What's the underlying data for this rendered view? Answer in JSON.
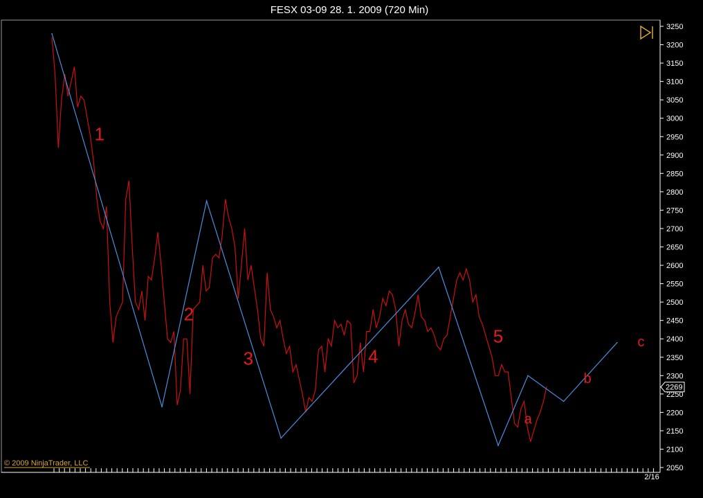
{
  "title": "FESX 03-09  28. 1. 2009 (720 Min)",
  "copyright": "© 2009 NinjaTrader, LLC",
  "last_price_label": "2269",
  "x_tick_label": "2/16",
  "colors": {
    "background": "#000000",
    "price_line": "#cc1111",
    "wave_line": "#4a8fe0",
    "axis": "#ffffff",
    "label": "#e41b1b",
    "copyright": "#d9a930"
  },
  "icons": [
    "play-to-end-icon"
  ],
  "chart_data": {
    "type": "line",
    "ylim": [
      2050,
      3250
    ],
    "y_ticks": [
      2050,
      2100,
      2150,
      2200,
      2250,
      2300,
      2350,
      2400,
      2450,
      2500,
      2550,
      2600,
      2650,
      2700,
      2750,
      2800,
      2850,
      2900,
      2950,
      3000,
      3050,
      3100,
      3150,
      3200,
      3250
    ],
    "y_axis_position": "right",
    "x_tick_labels": [
      "2/16"
    ],
    "grid": false,
    "series": [
      {
        "role": "price",
        "values": [
          3220,
          3120,
          2920,
          3050,
          3120,
          3060,
          3100,
          3140,
          3030,
          3060,
          3050,
          3000,
          2950,
          2880,
          2780,
          2720,
          2700,
          2760,
          2500,
          2390,
          2460,
          2480,
          2500,
          2780,
          2830,
          2650,
          2500,
          2480,
          2530,
          2450,
          2570,
          2560,
          2620,
          2690,
          2600,
          2500,
          2400,
          2390,
          2420,
          2220,
          2260,
          2400,
          2400,
          2250,
          2480,
          2490,
          2500,
          2600,
          2530,
          2540,
          2620,
          2630,
          2620,
          2680,
          2780,
          2730,
          2700,
          2650,
          2510,
          2600,
          2700,
          2560,
          2600,
          2540,
          2480,
          2400,
          2380,
          2580,
          2480,
          2460,
          2430,
          2450,
          2400,
          2360,
          2380,
          2310,
          2330,
          2290,
          2250,
          2200,
          2240,
          2230,
          2260,
          2370,
          2380,
          2310,
          2400,
          2380,
          2450,
          2430,
          2440,
          2410,
          2450,
          2440,
          2280,
          2300,
          2390,
          2310,
          2420,
          2420,
          2480,
          2430,
          2460,
          2510,
          2490,
          2530,
          2520,
          2480,
          2380,
          2450,
          2480,
          2440,
          2430,
          2470,
          2520,
          2460,
          2450,
          2420,
          2430,
          2410,
          2380,
          2370,
          2400,
          2410,
          2460,
          2510,
          2560,
          2580,
          2560,
          2590,
          2560,
          2500,
          2520,
          2460,
          2440,
          2410,
          2380,
          2350,
          2300,
          2300,
          2330,
          2310,
          2310,
          2240,
          2170,
          2160,
          2210,
          2230,
          2160,
          2120,
          2150,
          2180,
          2200,
          2230,
          2270
        ]
      },
      {
        "role": "wave",
        "points": [
          {
            "x": 0,
            "y": 3230
          },
          {
            "x": 37,
            "y": 2215
          },
          {
            "x": 52,
            "y": 2775
          },
          {
            "x": 77,
            "y": 2130
          },
          {
            "x": 130,
            "y": 2595
          },
          {
            "x": 150,
            "y": 2110
          },
          {
            "x": 160,
            "y": 2300
          },
          {
            "x": 172,
            "y": 2230
          },
          {
            "x": 190,
            "y": 2390
          }
        ]
      }
    ],
    "wave_labels": [
      {
        "text": "1",
        "x": 16,
        "y": 2940
      },
      {
        "text": "2",
        "x": 46,
        "y": 2450
      },
      {
        "text": "3",
        "x": 66,
        "y": 2330
      },
      {
        "text": "4",
        "x": 108,
        "y": 2335
      },
      {
        "text": "5",
        "x": 150,
        "y": 2390
      },
      {
        "text": "a",
        "x": 160,
        "y": 2170
      },
      {
        "text": "b",
        "x": 180,
        "y": 2280
      },
      {
        "text": "c",
        "x": 198,
        "y": 2380
      }
    ],
    "last_price": 2269
  }
}
